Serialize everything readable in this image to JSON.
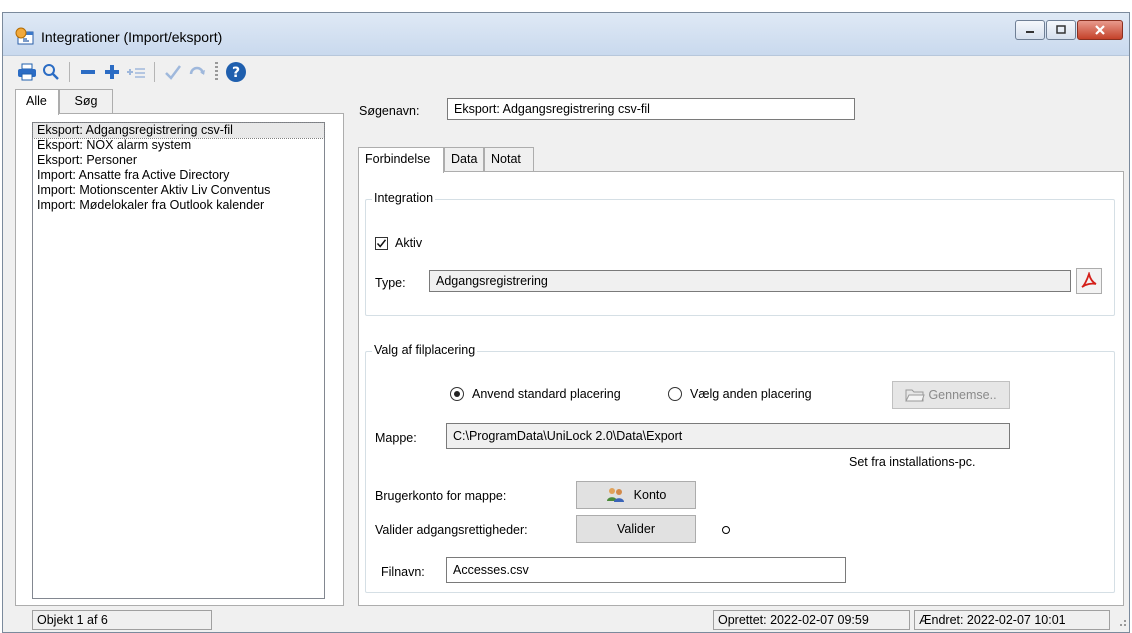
{
  "window": {
    "title": "Integrationer  (Import/eksport)"
  },
  "toolbar": {
    "items": [
      "printer-icon",
      "magnifier-icon",
      "minus-icon",
      "plus-icon",
      "add-list-icon",
      "checkmark-icon",
      "refresh-icon",
      "help-icon"
    ]
  },
  "left_tabs": [
    {
      "label": "Alle",
      "active": true
    },
    {
      "label": "Søg",
      "active": false
    }
  ],
  "list": {
    "items": [
      "Eksport: Adgangsregistrering csv-fil",
      "Eksport: NOX alarm system",
      "Eksport: Personer",
      "Import: Ansatte fra Active Directory",
      "Import: Motionscenter Aktiv Liv Conventus",
      "Import: Mødelokaler fra Outlook kalender"
    ],
    "selected_index": 0
  },
  "search_name": {
    "label": "Søgenavn:",
    "value": "Eksport: Adgangsregistrering csv-fil"
  },
  "right_tabs": [
    {
      "label": "Forbindelse",
      "active": true
    },
    {
      "label": "Data",
      "active": false
    },
    {
      "label": "Notat",
      "active": false
    }
  ],
  "integration": {
    "group_title": "Integration",
    "active_label": "Aktiv",
    "active_checked": true,
    "type_label": "Type:",
    "type_value": "Adgangsregistrering"
  },
  "file_location": {
    "group_title": "Valg af filplacering",
    "radio_standard": "Anvend standard placering",
    "radio_other": "Vælg anden placering",
    "selected": "standard",
    "browse_label": "Gennemse..",
    "folder_label": "Mappe:",
    "folder_value": "C:\\ProgramData\\UniLock 2.0\\Data\\Export",
    "set_from_note": "Set fra installations-pc.",
    "account_label": "Brugerkonto for mappe:",
    "account_button": "Konto",
    "validate_label": "Valider adgangsrettigheder:",
    "validate_button": "Valider",
    "filename_label": "Filnavn:",
    "filename_value": "Accesses.csv"
  },
  "status": {
    "object": "Objekt 1 af 6",
    "created": "Oprettet: 2022-02-07  09:59",
    "changed": "Ændret: 2022-02-07  10:01"
  }
}
